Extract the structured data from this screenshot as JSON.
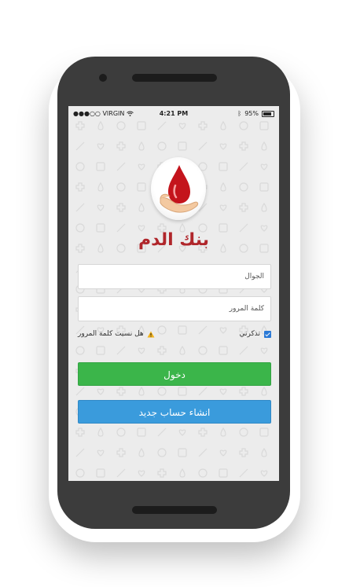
{
  "status_bar": {
    "carrier": "●●●○○ VIRGIN",
    "time": "4:21 PM",
    "battery": "95%"
  },
  "app": {
    "title": "بنك الدم"
  },
  "form": {
    "phone_placeholder": "الجوال",
    "password_placeholder": "كلمة المرور",
    "remember_label": "تذكرني",
    "remember_checked": true,
    "forgot_label": "هل نسيت كلمة المرور",
    "login_label": "دخول",
    "register_label": "انشاء حساب جديد"
  },
  "colors": {
    "brand_red": "#b0262b",
    "login_green": "#3bb54a",
    "register_blue": "#3a9bdc"
  }
}
